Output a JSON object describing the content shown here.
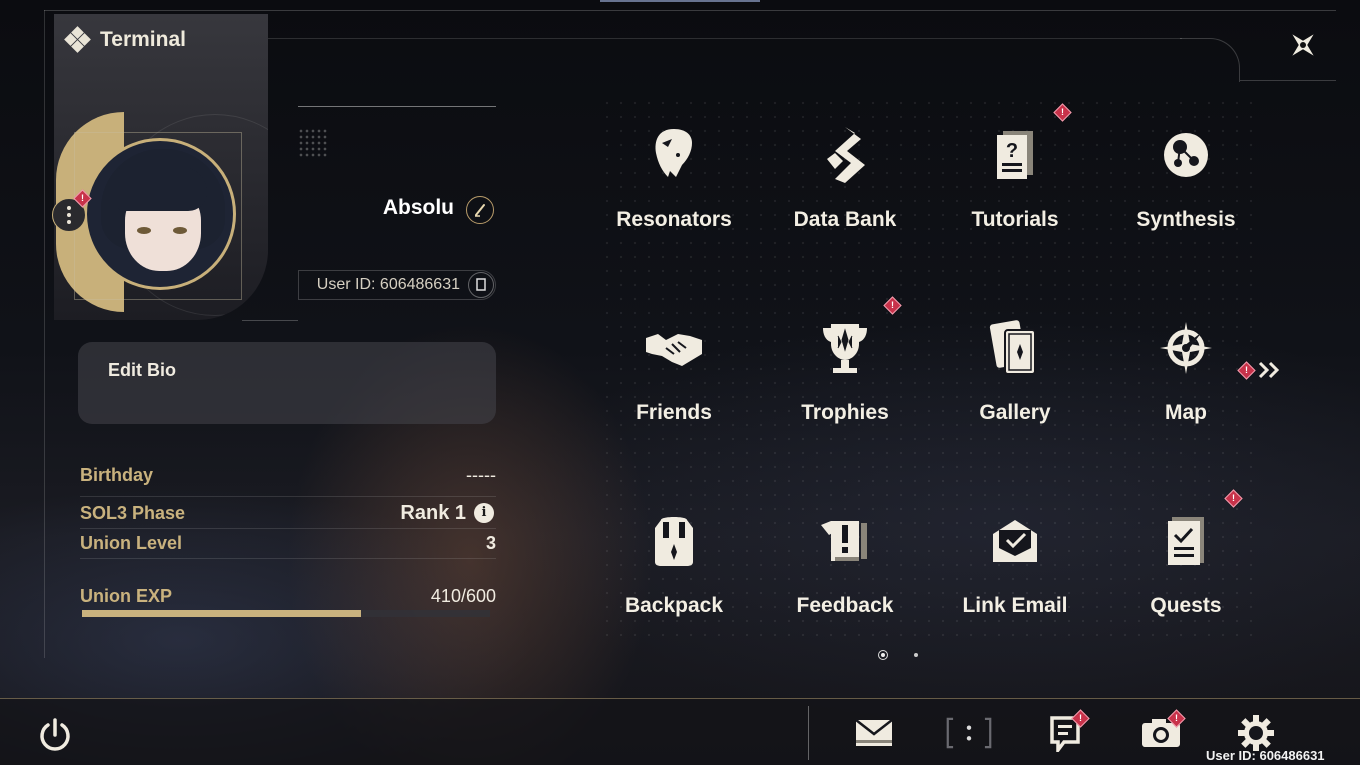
{
  "header": {
    "title": "Terminal"
  },
  "profile": {
    "username": "Absolu",
    "user_id_label": "User ID: 606486631",
    "bio_placeholder": "Edit Bio",
    "stats": [
      {
        "label": "Birthday",
        "value": "-----"
      },
      {
        "label": "SOL3 Phase",
        "value": "Rank 1"
      },
      {
        "label": "Union Level",
        "value": "3"
      },
      {
        "label": "Union EXP",
        "value": "410/600"
      }
    ],
    "exp_fraction": 0.683
  },
  "menu": [
    {
      "label": "Resonators",
      "icon": "resonators-icon",
      "alert": false
    },
    {
      "label": "Data Bank",
      "icon": "data-bank-icon",
      "alert": false
    },
    {
      "label": "Tutorials",
      "icon": "tutorials-icon",
      "alert": true
    },
    {
      "label": "Synthesis",
      "icon": "synthesis-icon",
      "alert": false
    },
    {
      "label": "Friends",
      "icon": "handshake-icon",
      "alert": false
    },
    {
      "label": "Trophies",
      "icon": "trophy-icon",
      "alert": true
    },
    {
      "label": "Gallery",
      "icon": "gallery-cards-icon",
      "alert": false
    },
    {
      "label": "Map",
      "icon": "compass-icon",
      "alert": false
    },
    {
      "label": "Backpack",
      "icon": "backpack-icon",
      "alert": false
    },
    {
      "label": "Feedback",
      "icon": "feedback-icon",
      "alert": false
    },
    {
      "label": "Link Email",
      "icon": "email-link-icon",
      "alert": false
    },
    {
      "label": "Quests",
      "icon": "quests-icon",
      "alert": true
    }
  ],
  "pager": {
    "current": 1,
    "total": 2
  },
  "bottom_bar": {
    "icons": [
      "power-icon",
      "mail-icon",
      "chat-bracket-icon",
      "notice-icon",
      "camera-icon",
      "settings-gear-icon"
    ],
    "user_id": "User ID: 606486631"
  },
  "colors": {
    "accent_gold": "#c9b27e",
    "alert_red": "#c8324a",
    "text_light": "#f3efe4"
  }
}
